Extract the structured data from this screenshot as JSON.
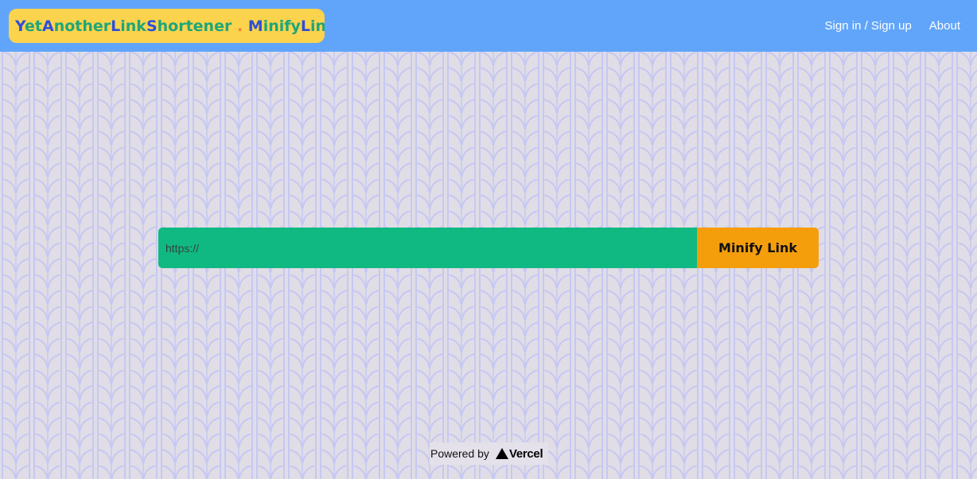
{
  "header": {
    "logo_segments": [
      {
        "text": "Y",
        "style": "cap"
      },
      {
        "text": "et",
        "style": "low"
      },
      {
        "text": "A",
        "style": "cap"
      },
      {
        "text": "nother",
        "style": "low"
      },
      {
        "text": "L",
        "style": "cap"
      },
      {
        "text": "ink",
        "style": "low"
      },
      {
        "text": "S",
        "style": "cap"
      },
      {
        "text": "hortener",
        "style": "low"
      },
      {
        "text": " . ",
        "style": "dot"
      },
      {
        "text": "M",
        "style": "cap"
      },
      {
        "text": "inify",
        "style": "low"
      },
      {
        "text": "L",
        "style": "cap"
      },
      {
        "text": "ink",
        "style": "low"
      }
    ],
    "nav": {
      "signin_label": "Sign in / Sign up",
      "about_label": "About"
    }
  },
  "form": {
    "url_placeholder": "https://",
    "url_value": "",
    "submit_label": "Minify Link"
  },
  "footer": {
    "powered_label": "Powered by",
    "vercel_label": "Vercel"
  },
  "colors": {
    "navbar": "#60a5fa",
    "logo_bg": "#fcd34d",
    "logo_capitals": "#2c4fd6",
    "logo_lowercase": "#1ea67a",
    "input_bg": "#10b981",
    "button_bg": "#f59e0b",
    "page_bg": "#e0dde6",
    "pattern_stroke": "#c6c8f2"
  },
  "icons": {
    "vercel": "vercel-triangle-icon"
  }
}
